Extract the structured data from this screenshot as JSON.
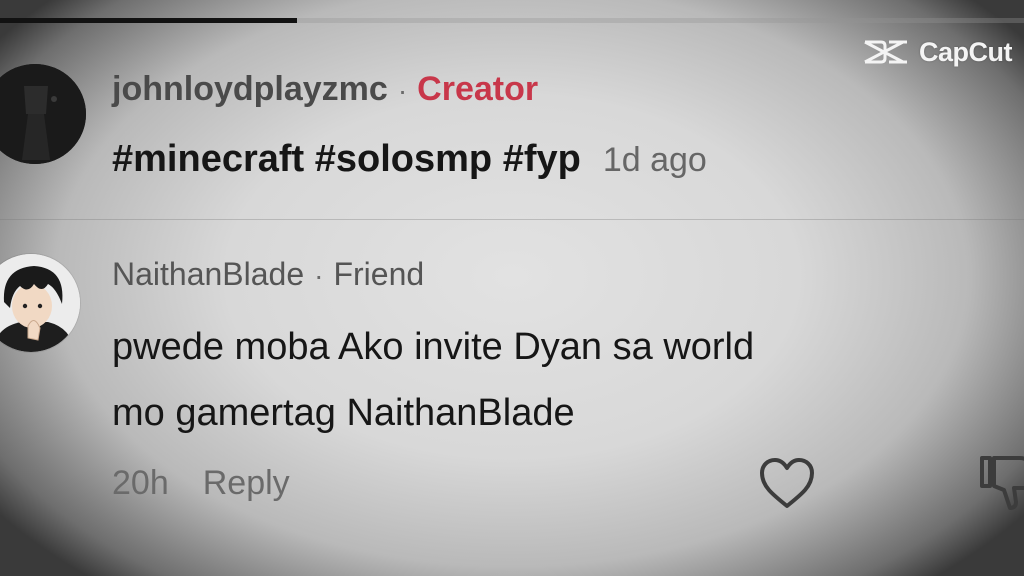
{
  "progress": {
    "fraction": 0.29
  },
  "watermark": {
    "text": "CapCut",
    "icon": "capcut-logo-icon"
  },
  "comments": [
    {
      "username": "johnloydplayzmc",
      "separator": "·",
      "badge": "Creator",
      "text": "#minecraft #solosmp #fyp",
      "timestamp": "1d ago"
    },
    {
      "username": "NaithanBlade",
      "separator": "·",
      "badge": "Friend",
      "line1": "pwede moba Ako invite Dyan sa world",
      "line2": "mo gamertag NaithanBlade",
      "timestamp": "20h",
      "reply_label": "Reply",
      "like_icon": "heart-icon",
      "dislike_icon": "thumbs-down-icon"
    }
  ],
  "colors": {
    "creator_badge": "#c8374a",
    "progress": "#121212"
  }
}
